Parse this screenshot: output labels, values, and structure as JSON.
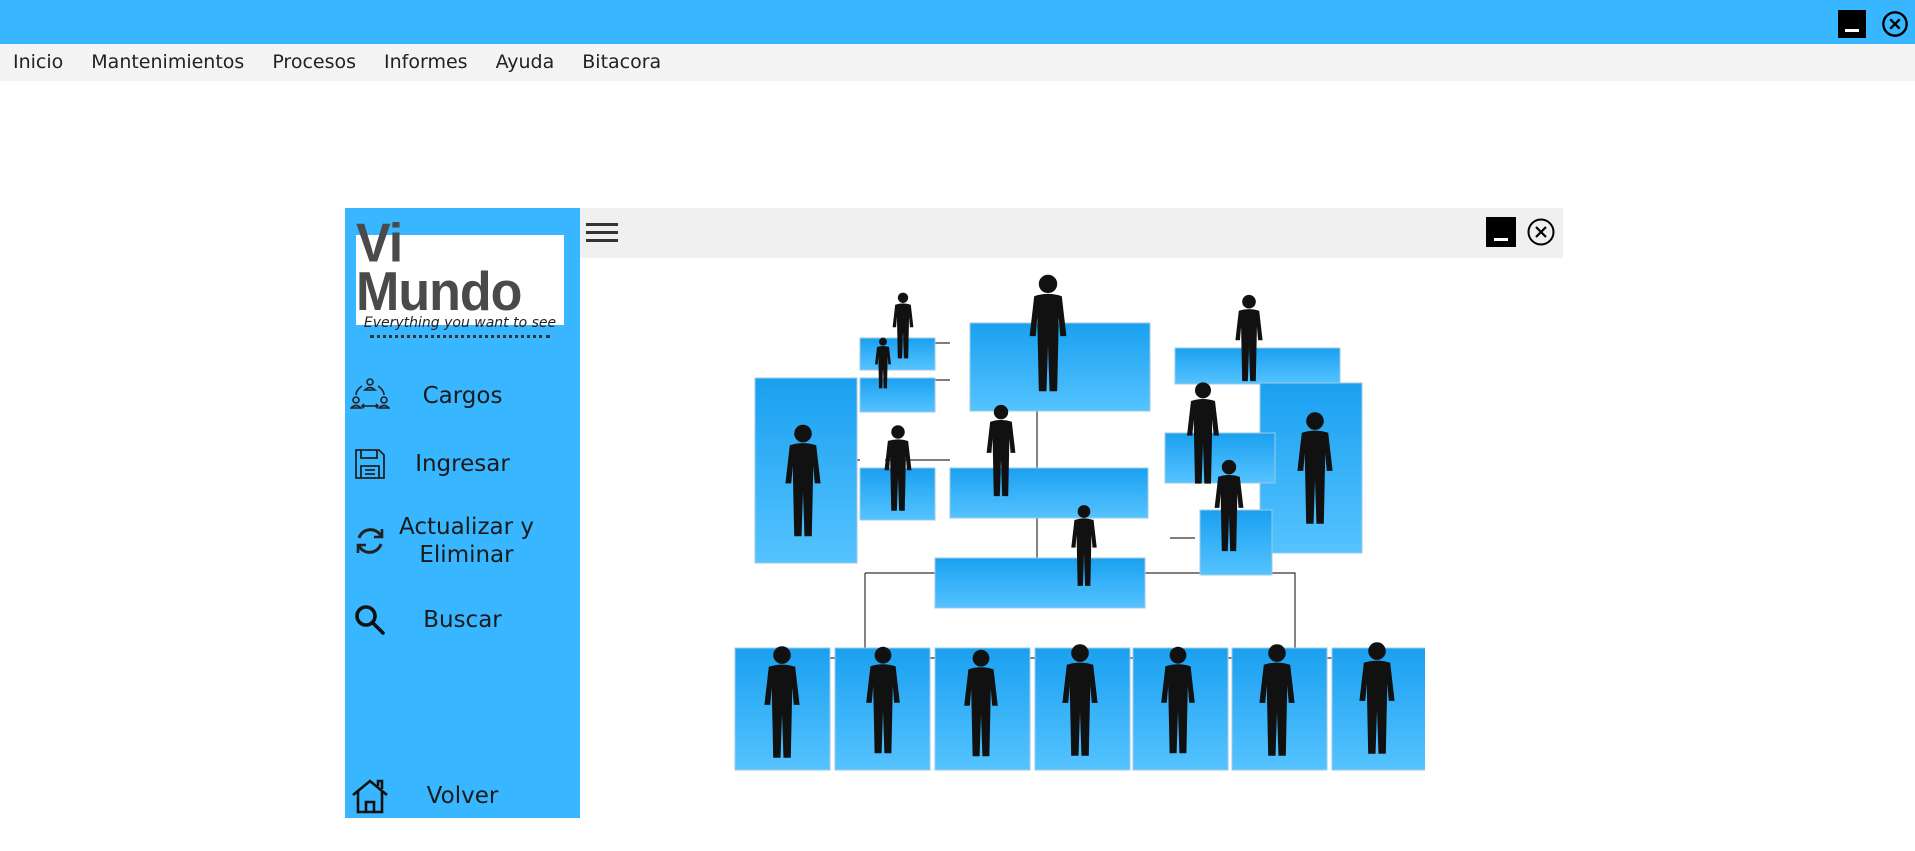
{
  "window": {
    "minimize_icon": "minimize-icon",
    "close_icon": "close-circle-icon",
    "accent_color": "#38b6ff"
  },
  "menu": {
    "items": [
      "Inicio",
      "Mantenimientos",
      "Procesos",
      "Informes",
      "Ayuda",
      "Bitacora"
    ]
  },
  "logo": {
    "title": "Vi Mundo",
    "subtitle": "Everything you want to see"
  },
  "sidebar": {
    "buttons": [
      {
        "label": "Cargos",
        "icon": "org-people-icon"
      },
      {
        "label": "Ingresar",
        "icon": "floppy-disk-icon"
      },
      {
        "label": "Actualizar y Eliminar",
        "icon": "refresh-icon"
      },
      {
        "label": "Buscar",
        "icon": "search-icon"
      },
      {
        "label": "Volver",
        "icon": "home-icon"
      }
    ]
  },
  "content": {
    "menu_icon": "hamburger-icon",
    "image": "org-chart-silhouettes"
  }
}
